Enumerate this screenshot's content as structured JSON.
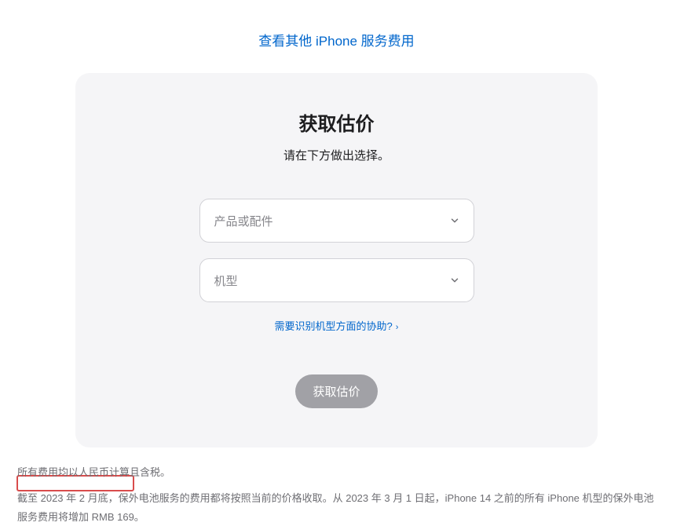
{
  "topLink": "查看其他 iPhone 服务费用",
  "card": {
    "title": "获取估价",
    "subtitle": "请在下方做出选择。",
    "select1": "产品或配件",
    "select2": "机型",
    "helpLink": "需要识别机型方面的协助?",
    "button": "获取估价"
  },
  "disclaimer": {
    "line1": "所有费用均以人民币计算且含税。",
    "line2": "截至 2023 年 2 月底，保外电池服务的费用都将按照当前的价格收取。从 2023 年 3 月 1 日起，iPhone 14 之前的所有 iPhone 机型的保外电池服务费用将增加 RMB 169。"
  }
}
